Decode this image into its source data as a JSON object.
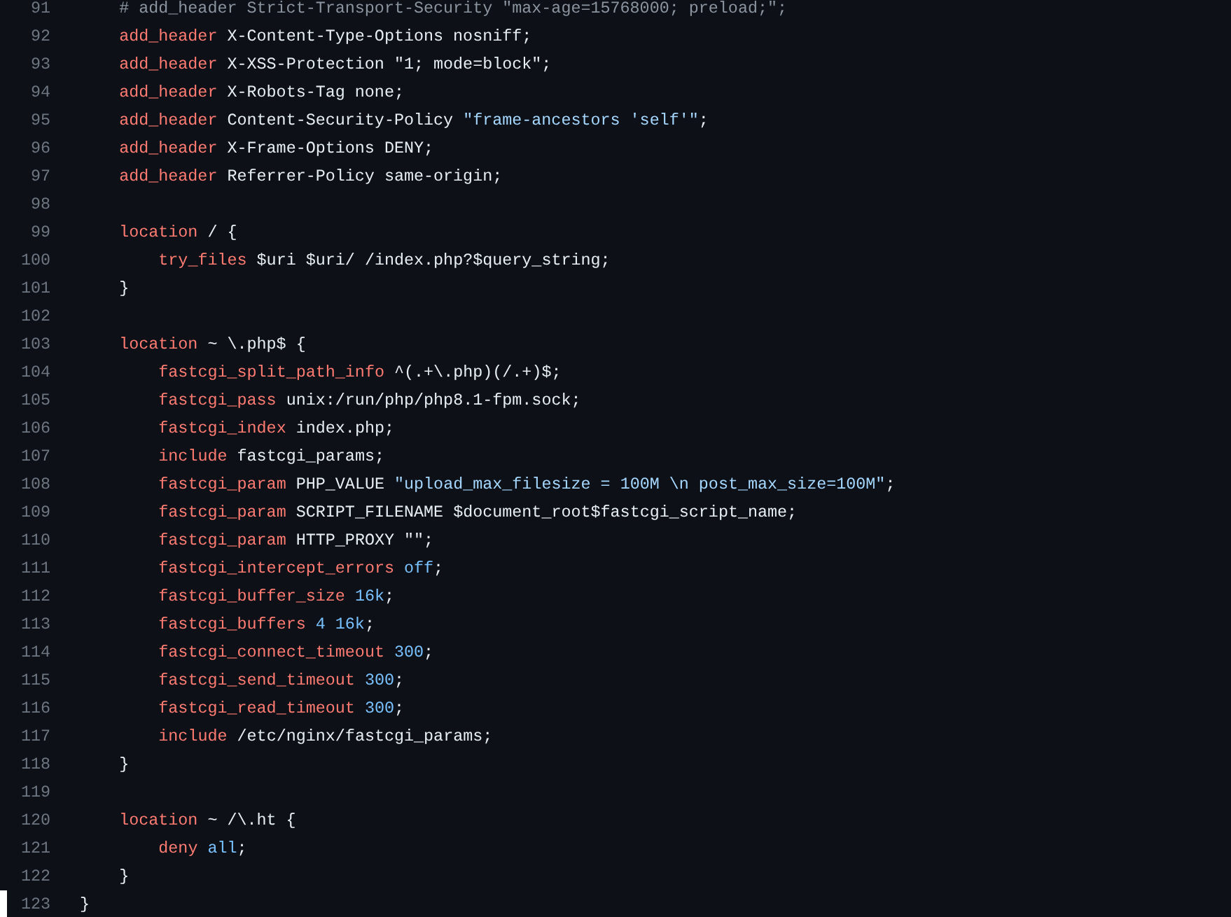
{
  "server_block": {
    "lines": [
      {
        "number": "91",
        "tokens": [
          {
            "kind": "comment",
            "text": "# add_header Strict-Transport-Security \"max-age=15768000; preload;\";"
          }
        ]
      },
      {
        "number": "92",
        "tokens": [
          {
            "kind": "keyword",
            "text": "add_header"
          },
          {
            "kind": "plain",
            "text": " X-Content-Type-Options nosniff;"
          }
        ]
      },
      {
        "number": "93",
        "tokens": [
          {
            "kind": "keyword",
            "text": "add_header"
          },
          {
            "kind": "plain",
            "text": " X-XSS-Protection \"1; mode=block\";"
          }
        ]
      },
      {
        "number": "94",
        "tokens": [
          {
            "kind": "keyword",
            "text": "add_header"
          },
          {
            "kind": "plain",
            "text": " X-Robots-Tag none;"
          }
        ]
      },
      {
        "number": "95",
        "tokens": [
          {
            "kind": "keyword",
            "text": "add_header"
          },
          {
            "kind": "plain",
            "text": " Content-Security-Policy "
          },
          {
            "kind": "string",
            "text": "\"frame-ancestors 'self'\""
          },
          {
            "kind": "plain",
            "text": ";"
          }
        ]
      },
      {
        "number": "96",
        "tokens": [
          {
            "kind": "keyword",
            "text": "add_header"
          },
          {
            "kind": "plain",
            "text": " X-Frame-Options DENY;"
          }
        ]
      },
      {
        "number": "97",
        "tokens": [
          {
            "kind": "keyword",
            "text": "add_header"
          },
          {
            "kind": "plain",
            "text": " Referrer-Policy same-origin;"
          }
        ]
      },
      {
        "number": "98"
      },
      {
        "number": "99",
        "tokens": [
          {
            "kind": "keyword",
            "text": "location"
          },
          {
            "kind": "plain",
            "text": " / {"
          }
        ],
        "children": [
          {
            "number": "100",
            "tokens": [
              {
                "kind": "keyword",
                "text": "try_files"
              },
              {
                "kind": "plain",
                "text": " $uri $uri/ /index.php?$query_string;"
              }
            ]
          }
        ]
      },
      {
        "number": "101",
        "tokens": [
          {
            "kind": "plain",
            "text": "}"
          }
        ]
      },
      {
        "number": "102"
      },
      {
        "number": "103",
        "tokens": [
          {
            "kind": "keyword",
            "text": "location"
          },
          {
            "kind": "plain",
            "text": " ~ \\.php$ {"
          }
        ],
        "children": [
          {
            "number": "104",
            "tokens": [
              {
                "kind": "keyword",
                "text": "fastcgi_split_path_info"
              },
              {
                "kind": "plain",
                "text": " ^(.+\\.php)(/.+)$;"
              }
            ]
          },
          {
            "number": "105",
            "tokens": [
              {
                "kind": "keyword",
                "text": "fastcgi_pass"
              },
              {
                "kind": "plain",
                "text": " unix:/run/php/php8.1-fpm.sock;"
              }
            ]
          },
          {
            "number": "106",
            "tokens": [
              {
                "kind": "keyword",
                "text": "fastcgi_index"
              },
              {
                "kind": "plain",
                "text": " index.php;"
              }
            ]
          },
          {
            "number": "107",
            "tokens": [
              {
                "kind": "keyword",
                "text": "include"
              },
              {
                "kind": "plain",
                "text": " fastcgi_params;"
              }
            ]
          },
          {
            "number": "108",
            "tokens": [
              {
                "kind": "keyword",
                "text": "fastcgi_param"
              },
              {
                "kind": "plain",
                "text": " PHP_VALUE "
              },
              {
                "kind": "string",
                "text": "\"upload_max_filesize = 100M \\n post_max_size=100M\""
              },
              {
                "kind": "plain",
                "text": ";"
              }
            ]
          },
          {
            "number": "109",
            "tokens": [
              {
                "kind": "keyword",
                "text": "fastcgi_param"
              },
              {
                "kind": "plain",
                "text": " SCRIPT_FILENAME $document_root$fastcgi_script_name;"
              }
            ]
          },
          {
            "number": "110",
            "tokens": [
              {
                "kind": "keyword",
                "text": "fastcgi_param"
              },
              {
                "kind": "plain",
                "text": " HTTP_PROXY \"\";"
              }
            ]
          },
          {
            "number": "111",
            "tokens": [
              {
                "kind": "keyword",
                "text": "fastcgi_intercept_errors "
              },
              {
                "kind": "constant",
                "text": "off"
              },
              {
                "kind": "plain",
                "text": ";"
              }
            ]
          },
          {
            "number": "112",
            "tokens": [
              {
                "kind": "keyword",
                "text": "fastcgi_buffer_size "
              },
              {
                "kind": "constant",
                "text": "16k"
              },
              {
                "kind": "plain",
                "text": ";"
              }
            ]
          },
          {
            "number": "113",
            "tokens": [
              {
                "kind": "keyword",
                "text": "fastcgi_buffers "
              },
              {
                "kind": "constant",
                "text": "4 16k"
              },
              {
                "kind": "plain",
                "text": ";"
              }
            ]
          },
          {
            "number": "114",
            "tokens": [
              {
                "kind": "keyword",
                "text": "fastcgi_connect_timeout "
              },
              {
                "kind": "constant",
                "text": "300"
              },
              {
                "kind": "plain",
                "text": ";"
              }
            ]
          },
          {
            "number": "115",
            "tokens": [
              {
                "kind": "keyword",
                "text": "fastcgi_send_timeout "
              },
              {
                "kind": "constant",
                "text": "300"
              },
              {
                "kind": "plain",
                "text": ";"
              }
            ]
          },
          {
            "number": "116",
            "tokens": [
              {
                "kind": "keyword",
                "text": "fastcgi_read_timeout "
              },
              {
                "kind": "constant",
                "text": "300"
              },
              {
                "kind": "plain",
                "text": ";"
              }
            ]
          },
          {
            "number": "117",
            "tokens": [
              {
                "kind": "keyword",
                "text": "include"
              },
              {
                "kind": "plain",
                "text": " /etc/nginx/fastcgi_params;"
              }
            ]
          }
        ]
      },
      {
        "number": "118",
        "tokens": [
          {
            "kind": "plain",
            "text": "}"
          }
        ]
      },
      {
        "number": "119"
      },
      {
        "number": "120",
        "tokens": [
          {
            "kind": "keyword",
            "text": "location"
          },
          {
            "kind": "plain",
            "text": " ~ /\\.ht {"
          }
        ],
        "children": [
          {
            "number": "121",
            "tokens": [
              {
                "kind": "keyword",
                "text": "deny "
              },
              {
                "kind": "constant",
                "text": "all"
              },
              {
                "kind": "plain",
                "text": ";"
              }
            ]
          }
        ]
      },
      {
        "number": "122",
        "tokens": [
          {
            "kind": "plain",
            "text": "}"
          }
        ]
      }
    ]
  },
  "lines": [
    {
      "number": "123",
      "tokens": [
        {
          "kind": "plain",
          "text": "}"
        }
      ]
    }
  ]
}
